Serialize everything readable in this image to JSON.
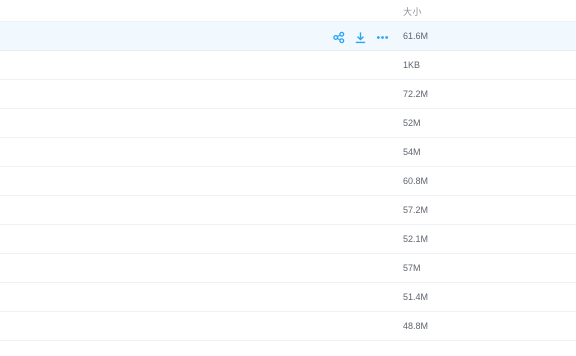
{
  "table": {
    "size_header": "大小",
    "rows": [
      {
        "size": "61.6M",
        "selected": true
      },
      {
        "size": "1KB"
      },
      {
        "size": "72.2M"
      },
      {
        "size": "52M"
      },
      {
        "size": "54M"
      },
      {
        "size": "60.8M"
      },
      {
        "size": "57.2M"
      },
      {
        "size": "52.1M"
      },
      {
        "size": "57M"
      },
      {
        "size": "51.4M"
      },
      {
        "size": "48.8M"
      }
    ]
  },
  "row_actions": [
    {
      "icon": "share-icon"
    },
    {
      "icon": "download-icon"
    },
    {
      "icon": "more-icon"
    }
  ],
  "colors": {
    "accent": "#2aa4f4",
    "selected_row_bg": "#f1f9ff",
    "divider": "#eef1f5"
  }
}
